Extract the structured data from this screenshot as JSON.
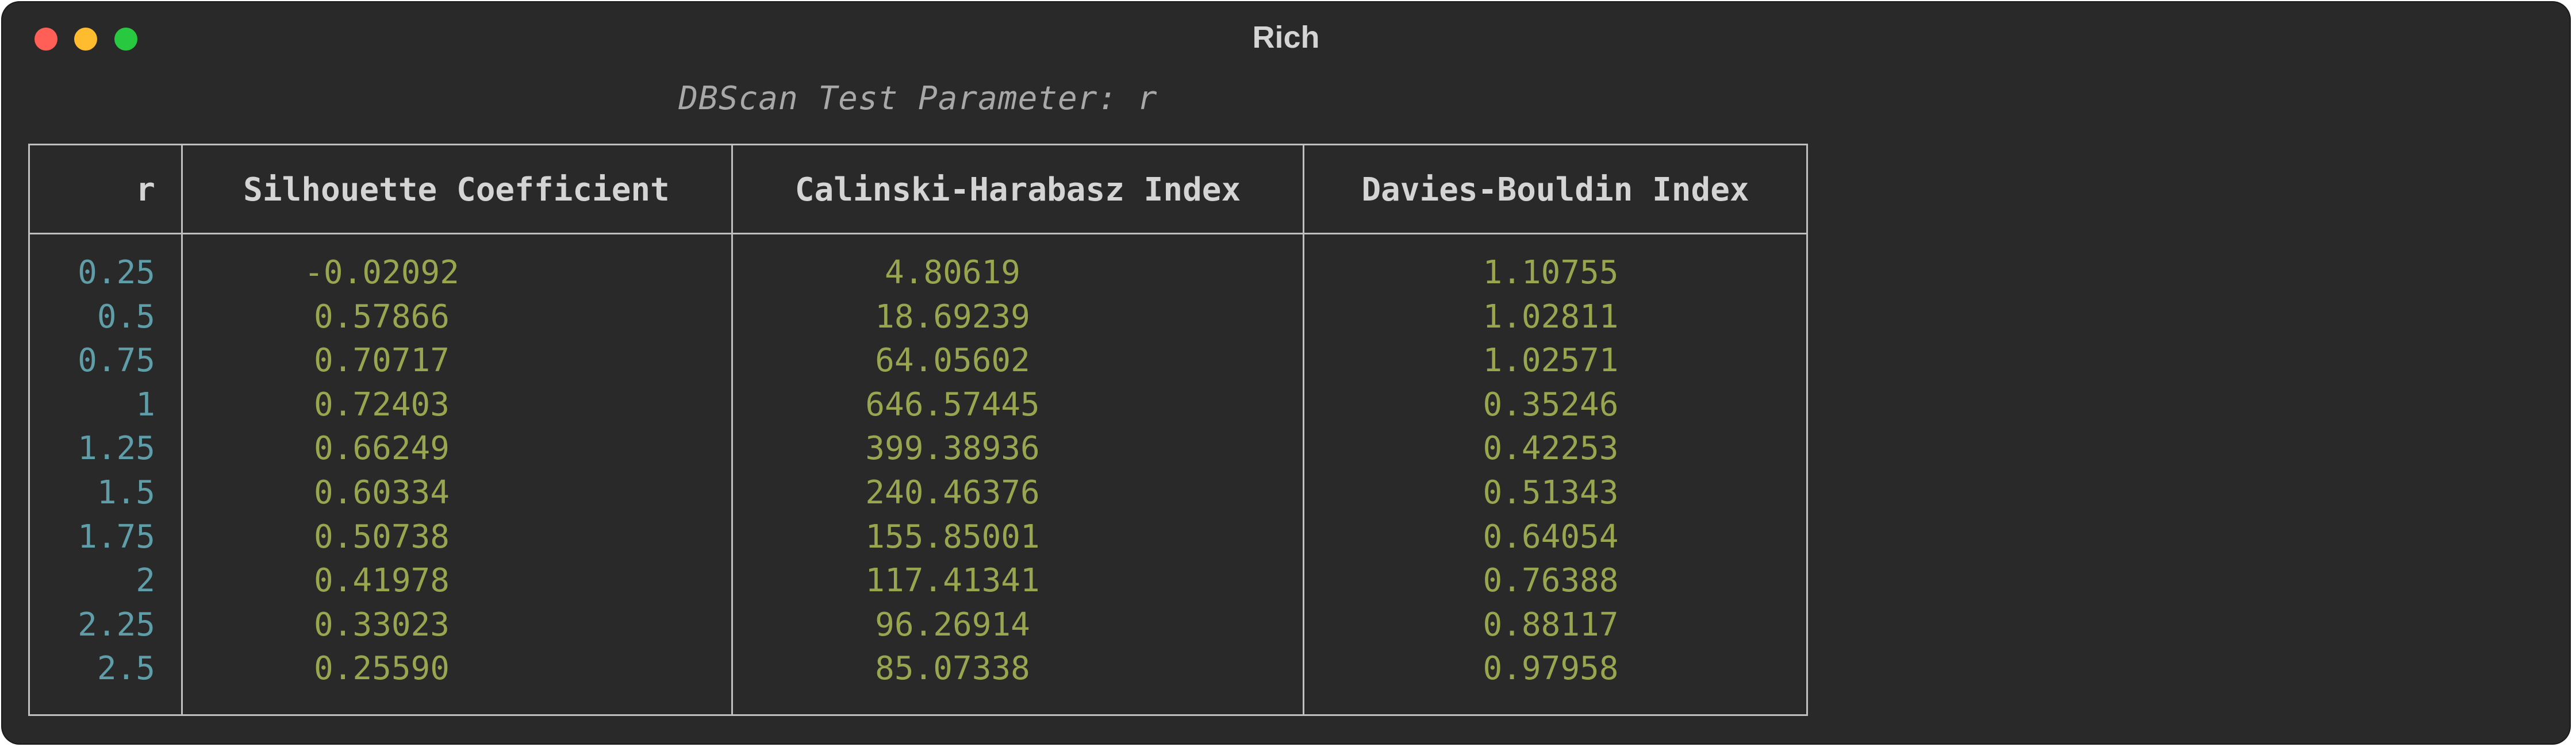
{
  "window": {
    "title": "Rich"
  },
  "caption": "DBScan Test Parameter: r",
  "table": {
    "headers": {
      "r": "r",
      "silhouette": "Silhouette Coefficient",
      "calinski": "Calinski-Harabasz Index",
      "davies": "Davies-Bouldin Index"
    },
    "rows": [
      {
        "r": "0.25",
        "silhouette": "-0.02092",
        "calinski": "4.80619",
        "davies": "1.10755"
      },
      {
        "r": "0.5",
        "silhouette": "0.57866",
        "calinski": "18.69239",
        "davies": "1.02811"
      },
      {
        "r": "0.75",
        "silhouette": "0.70717",
        "calinski": "64.05602",
        "davies": "1.02571"
      },
      {
        "r": "1",
        "silhouette": "0.72403",
        "calinski": "646.57445",
        "davies": "0.35246"
      },
      {
        "r": "1.25",
        "silhouette": "0.66249",
        "calinski": "399.38936",
        "davies": "0.42253"
      },
      {
        "r": "1.5",
        "silhouette": "0.60334",
        "calinski": "240.46376",
        "davies": "0.51343"
      },
      {
        "r": "1.75",
        "silhouette": "0.50738",
        "calinski": "155.85001",
        "davies": "0.64054"
      },
      {
        "r": "2",
        "silhouette": "0.41978",
        "calinski": "117.41341",
        "davies": "0.76388"
      },
      {
        "r": "2.25",
        "silhouette": "0.33023",
        "calinski": "96.26914",
        "davies": "0.88117"
      },
      {
        "r": "2.5",
        "silhouette": "0.25590",
        "calinski": "85.07338",
        "davies": "0.97958"
      }
    ]
  },
  "colors": {
    "window_bg": "#292929",
    "r_values": "#5f9ea8",
    "metric_values": "#9aa550",
    "header_text": "#d4d4d4",
    "border": "#bfbfbf"
  }
}
